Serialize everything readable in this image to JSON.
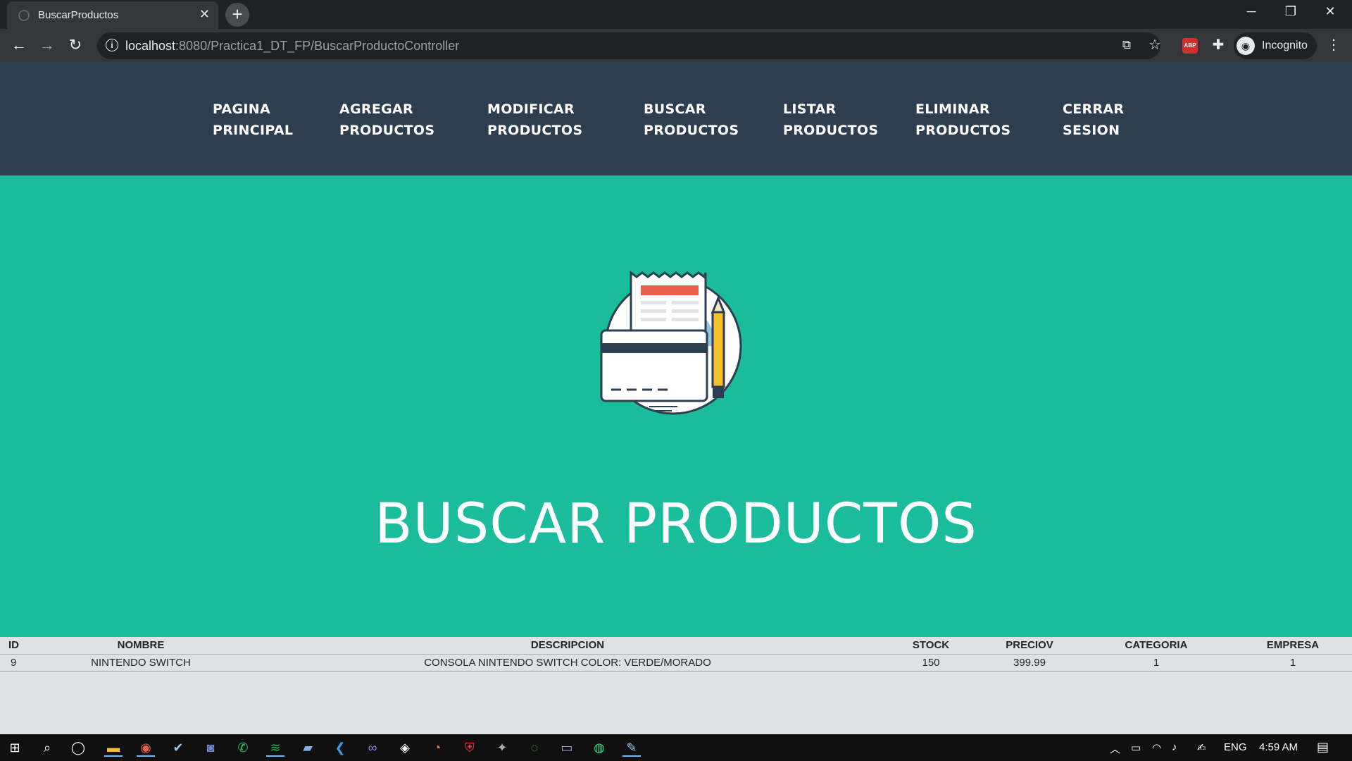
{
  "browser": {
    "tab_title": "BuscarProductos",
    "tab_close": "✕",
    "new_tab": "+",
    "url_host": "localhost",
    "url_rest": ":8080/Practica1_DT_FP/BuscarProductoController",
    "profile_label": "Incognito",
    "adblock_label": "ABP"
  },
  "site": {
    "nav": [
      {
        "line1": "PAGINA",
        "line2": "PRINCIPAL"
      },
      {
        "line1": "AGREGAR",
        "line2": "PRODUCTOS"
      },
      {
        "line1": "MODIFICAR",
        "line2": "PRODUCTOS"
      },
      {
        "line1": "BUSCAR",
        "line2": "PRODUCTOS"
      },
      {
        "line1": "LISTAR",
        "line2": "PRODUCTOS"
      },
      {
        "line1": "ELIMINAR",
        "line2": "PRODUCTOS"
      },
      {
        "line1": "CERRAR",
        "line2": "SESION"
      }
    ],
    "hero_title": "BUSCAR PRODUCTOS",
    "colors": {
      "navbar": "#2c3e50",
      "hero": "#1abc9c",
      "table_bg": "#dee2e6"
    }
  },
  "table": {
    "headers": [
      "ID",
      "NOMBRE",
      "DESCRIPCION",
      "STOCK",
      "PRECIOV",
      "CATEGORIA",
      "EMPRESA"
    ],
    "rows": [
      [
        "9",
        "NINTENDO SWITCH",
        "CONSOLA NINTENDO SWITCH COLOR: VERDE/MORADO",
        "150",
        "399.99",
        "1",
        "1"
      ]
    ]
  },
  "taskbar": {
    "language": "ENG",
    "time": "4:59 AM"
  }
}
